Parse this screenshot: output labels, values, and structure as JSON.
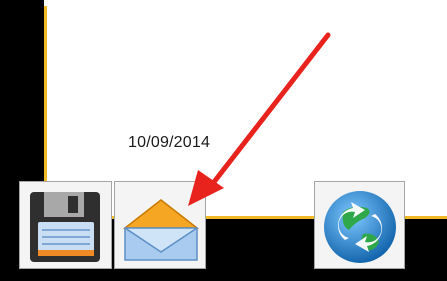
{
  "date": {
    "text": "10/09/2014"
  },
  "toolbar": {
    "buttons": [
      {
        "name": "save-button",
        "icon": "floppy-disk-icon"
      },
      {
        "name": "email-button",
        "icon": "envelope-icon"
      },
      {
        "name": "sync-button",
        "icon": "sync-globe-icon"
      }
    ]
  },
  "annotation": {
    "icon": "red-arrow-icon",
    "color": "#e8231d"
  },
  "colors": {
    "accent_border": "#f1b928",
    "background_dark": "#000000"
  }
}
